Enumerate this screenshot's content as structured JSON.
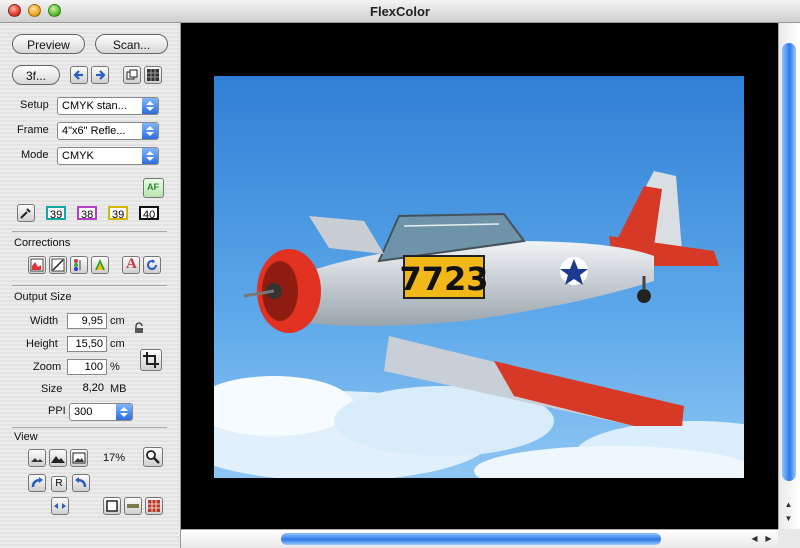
{
  "window": {
    "title": "FlexColor"
  },
  "toolbar": {
    "preview_label": "Preview",
    "scan_label": "Scan...",
    "three_f_label": "3f..."
  },
  "settings": {
    "setup_label": "Setup",
    "setup_value": "CMYK stan...",
    "frame_label": "Frame",
    "frame_value": "4\"x6\" Refle...",
    "mode_label": "Mode",
    "mode_value": "CMYK",
    "af_label": "AF"
  },
  "densitometer": {
    "values": [
      "39",
      "38",
      "39",
      "40"
    ],
    "colors": [
      "#18a7a7",
      "#b43fc4",
      "#d4b800",
      "#111111"
    ]
  },
  "corrections": {
    "title": "Corrections",
    "text_tool_glyph": "A"
  },
  "output_size": {
    "title": "Output Size",
    "width_label": "Width",
    "width_value": "9,95",
    "width_unit": "cm",
    "height_label": "Height",
    "height_value": "15,50",
    "height_unit": "cm",
    "zoom_label": "Zoom",
    "zoom_value": "100",
    "zoom_unit": "%",
    "size_label": "Size",
    "size_value": "8,20",
    "size_unit": "MB",
    "ppi_label": "PPI",
    "ppi_value": "300"
  },
  "view": {
    "title": "View",
    "zoom_value": "17%",
    "r_label": "R"
  },
  "image": {
    "plane_number": "7723",
    "sky_colors": [
      "#2f7fd6",
      "#5ea9ea",
      "#8ec6f3"
    ]
  }
}
